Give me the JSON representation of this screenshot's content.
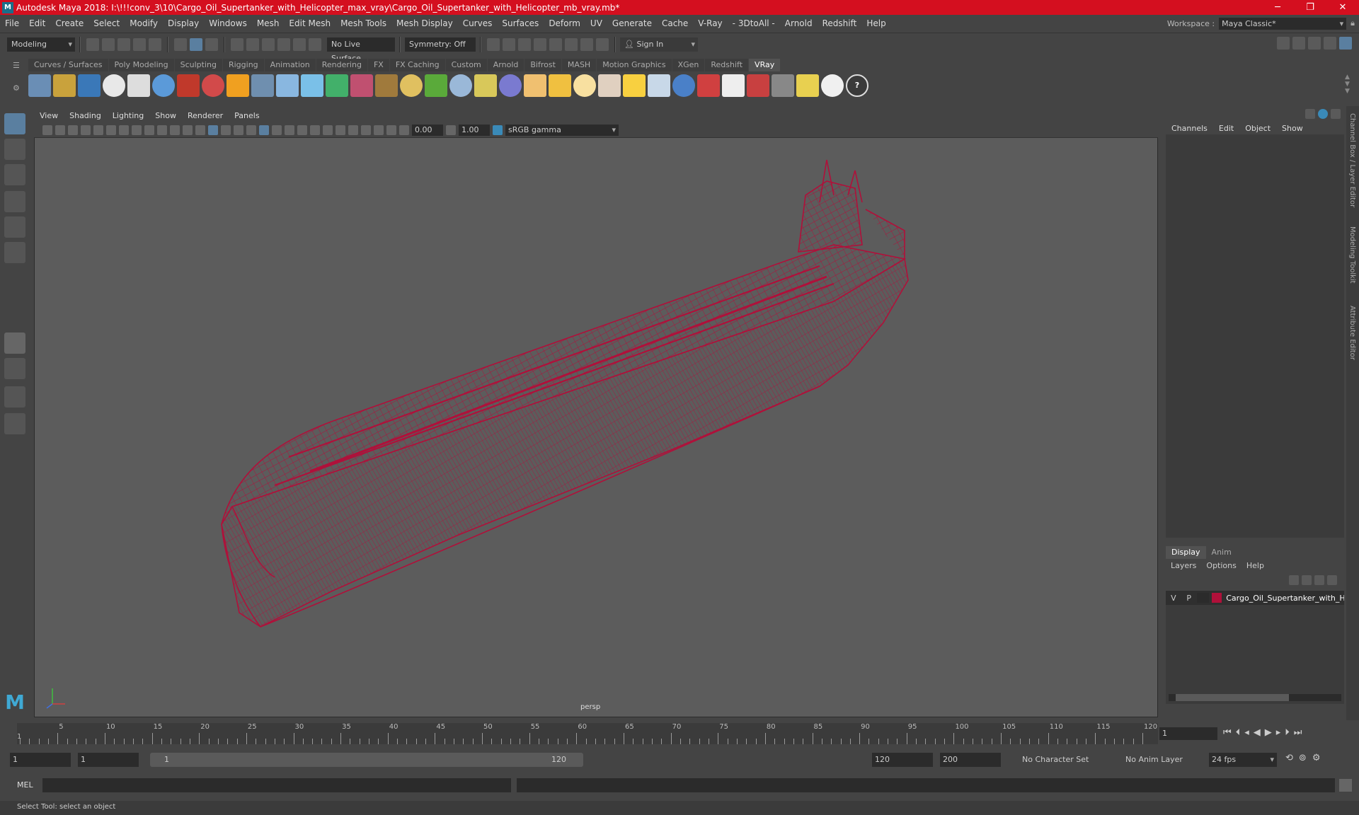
{
  "window": {
    "title": "Autodesk Maya 2018: I:\\!!!conv_3\\10\\Cargo_Oil_Supertanker_with_Helicopter_max_vray\\Cargo_Oil_Supertanker_with_Helicopter_mb_vray.mb*",
    "minimize": "─",
    "maximize": "❐",
    "close": "✕"
  },
  "menubar": {
    "items": [
      "File",
      "Edit",
      "Create",
      "Select",
      "Modify",
      "Display",
      "Windows",
      "Mesh",
      "Edit Mesh",
      "Mesh Tools",
      "Mesh Display",
      "Curves",
      "Surfaces",
      "Deform",
      "UV",
      "Generate",
      "Cache",
      "V-Ray",
      "- 3DtoAll -",
      "Arnold",
      "Redshift",
      "Help"
    ],
    "workspace_label": "Workspace :",
    "workspace_value": "Maya Classic*"
  },
  "statusline": {
    "mode": "Modeling",
    "live_surface": "No Live Surface",
    "symmetry": "Symmetry: Off",
    "sign_in": "Sign In"
  },
  "shelf": {
    "tabs": [
      "Curves / Surfaces",
      "Poly Modeling",
      "Sculpting",
      "Rigging",
      "Animation",
      "Rendering",
      "FX",
      "FX Caching",
      "Custom",
      "Arnold",
      "Bifrost",
      "MASH",
      "Motion Graphics",
      "XGen",
      "Redshift",
      "VRay"
    ],
    "active_tab": "VRay"
  },
  "viewport": {
    "menu": [
      "View",
      "Shading",
      "Lighting",
      "Show",
      "Renderer",
      "Panels"
    ],
    "exposure": "0.00",
    "gamma": "1.00",
    "color_space": "sRGB gamma",
    "camera_label": "persp",
    "wire_color": "#b0103a",
    "background": "#5c5c5c"
  },
  "channelbox": {
    "menu": [
      "Channels",
      "Edit",
      "Object",
      "Show"
    ],
    "side_tabs": [
      "Channel Box / Layer Editor",
      "Modeling Toolkit",
      "Attribute Editor"
    ]
  },
  "layers": {
    "tabs": [
      "Display",
      "Anim"
    ],
    "menu": [
      "Layers",
      "Options",
      "Help"
    ],
    "row": {
      "v": "V",
      "p": "P",
      "name": "Cargo_Oil_Supertanker_with_H",
      "color": "#b0103a"
    }
  },
  "timeline": {
    "ticks": [
      "5",
      "10",
      "15",
      "20",
      "25",
      "30",
      "35",
      "40",
      "45",
      "50",
      "55",
      "60",
      "65",
      "70",
      "75",
      "80",
      "85",
      "90",
      "95",
      "100",
      "105",
      "110",
      "115",
      "120"
    ],
    "start_marker": "1",
    "current_frame": "1"
  },
  "range": {
    "start": "1",
    "playback_start": "1",
    "slider_start": "1",
    "slider_end": "120",
    "playback_end": "120",
    "end": "200",
    "character_set": "No Character Set",
    "anim_layer": "No Anim Layer",
    "fps": "24 fps"
  },
  "mel": {
    "label": "MEL"
  },
  "help": {
    "text": "Select Tool: select an object"
  }
}
